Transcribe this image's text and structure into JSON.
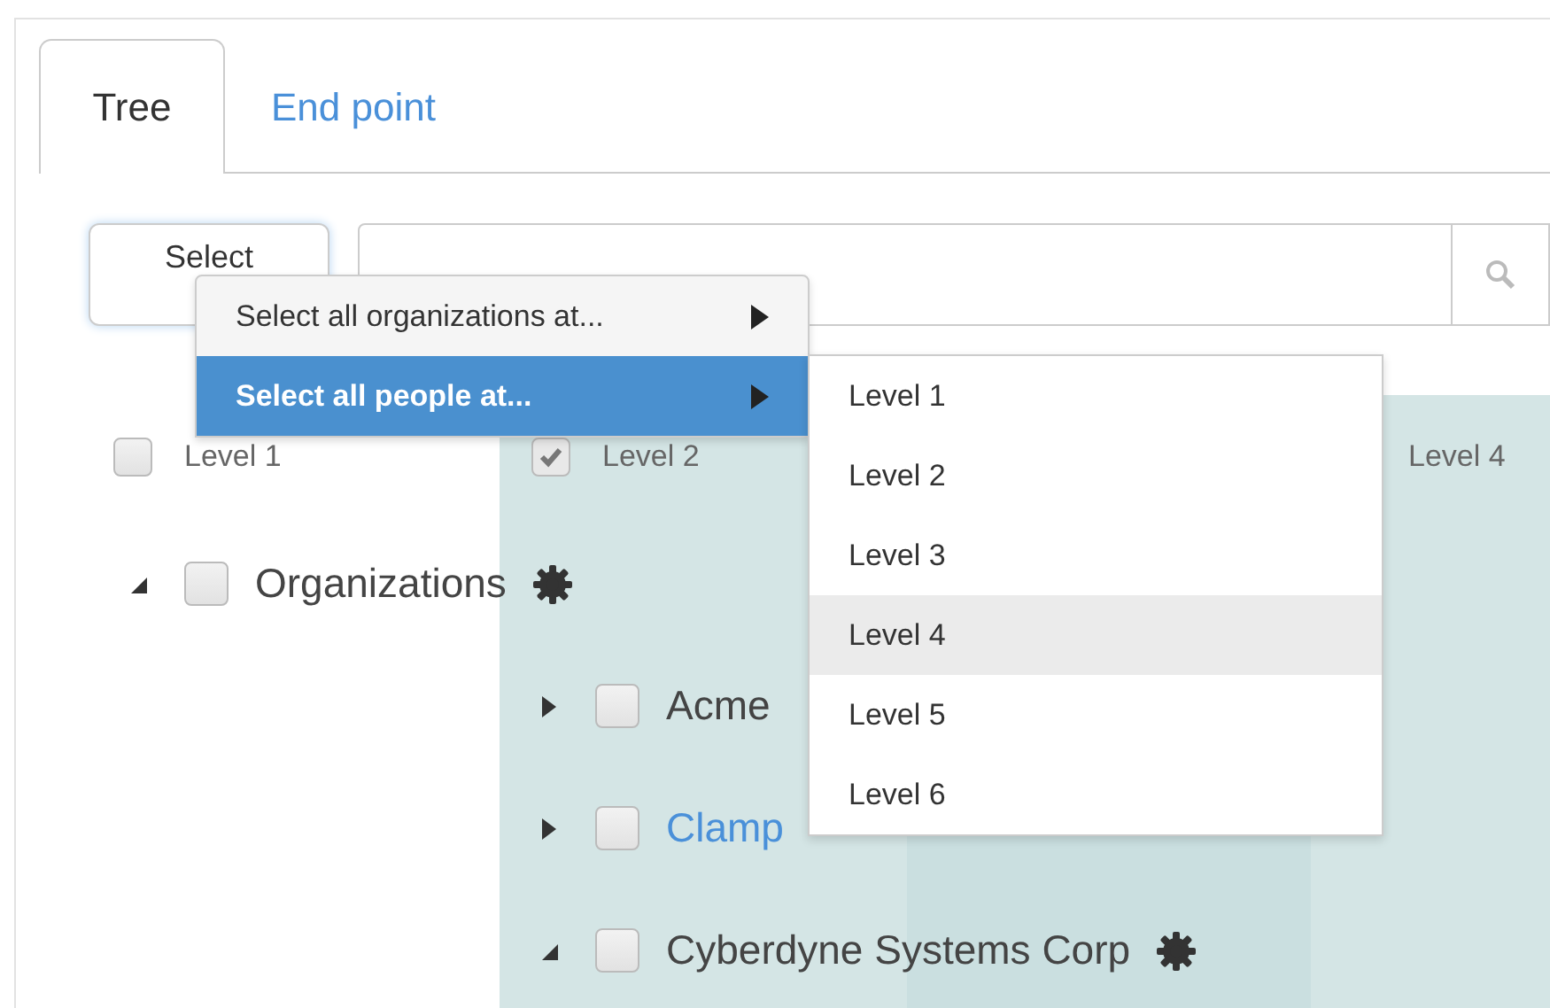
{
  "tabs": [
    {
      "label": "Tree",
      "selected": true
    },
    {
      "label": "End point",
      "selected": false
    }
  ],
  "toolbar": {
    "select_button": "Select"
  },
  "levels": [
    {
      "label": "Level 1",
      "checked": false
    },
    {
      "label": "Level 2",
      "checked": true
    },
    {
      "label": "Level 4"
    }
  ],
  "tree": [
    {
      "label": "Organizations",
      "checked": false,
      "expanded": true,
      "gear": true,
      "highlighted": false,
      "children": [
        {
          "label": "Acme",
          "checked": false,
          "expanded": false,
          "gear": false,
          "highlighted": false
        },
        {
          "label": "Clamp",
          "checked": false,
          "expanded": false,
          "gear": false,
          "highlighted": true
        },
        {
          "label": "Cyberdyne Systems Corp",
          "checked": false,
          "expanded": true,
          "gear": true,
          "highlighted": false
        }
      ]
    }
  ],
  "menu": [
    {
      "label": "Select all organizations at...",
      "selected": false,
      "has_submenu": true
    },
    {
      "label": "Select all people at...",
      "selected": true,
      "has_submenu": true
    }
  ],
  "submenu": [
    {
      "label": "Level 1",
      "selected": false
    },
    {
      "label": "Level 2",
      "selected": false
    },
    {
      "label": "Level 3",
      "selected": false
    },
    {
      "label": "Level 4",
      "selected": true
    },
    {
      "label": "Level 5",
      "selected": false
    },
    {
      "label": "Level 6",
      "selected": false
    }
  ]
}
